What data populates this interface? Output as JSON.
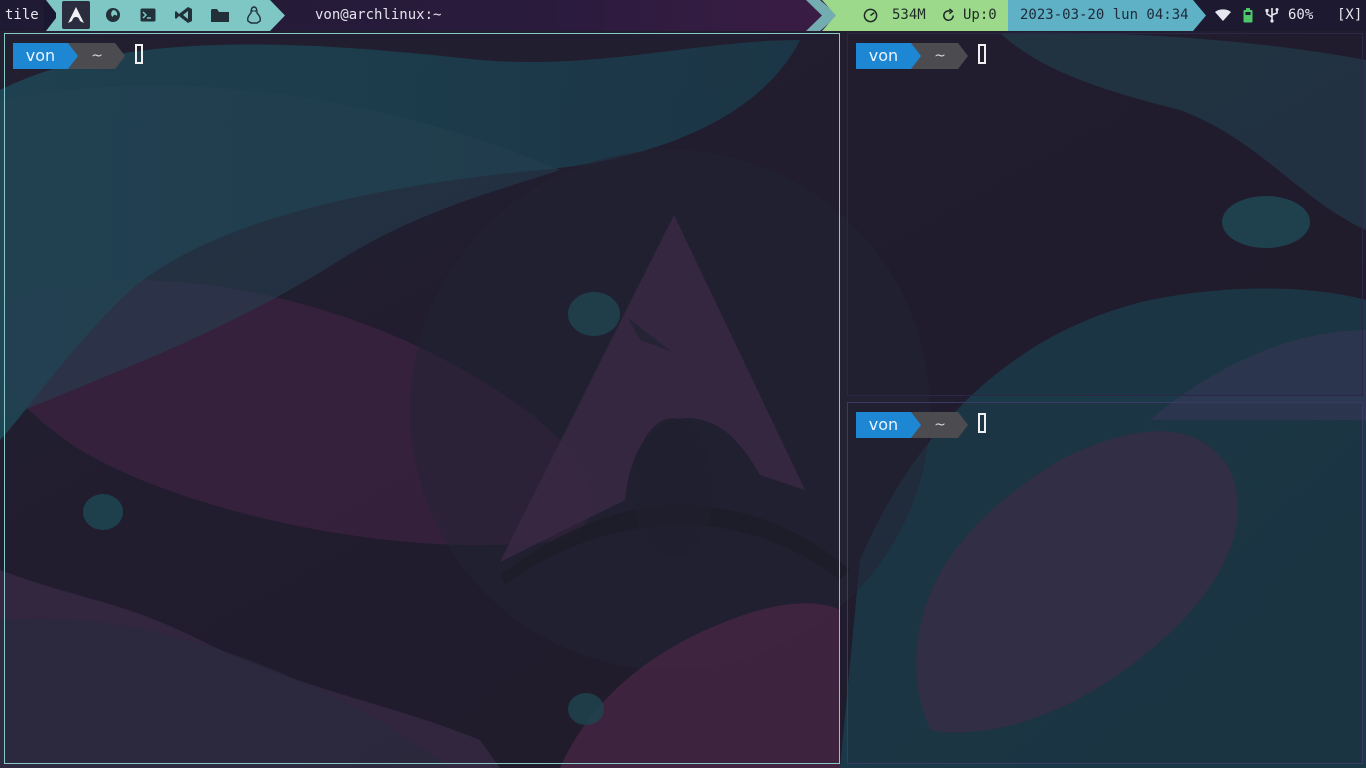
{
  "topbar": {
    "layout_label": "tile",
    "workspaces": [
      {
        "icon": "arch-logo-icon",
        "active": true
      },
      {
        "icon": "firefox-icon",
        "active": false
      },
      {
        "icon": "terminal-icon",
        "active": false
      },
      {
        "icon": "vscode-icon",
        "active": false
      },
      {
        "icon": "folder-icon",
        "active": false
      },
      {
        "icon": "linux-tux-icon",
        "active": false
      }
    ],
    "window_title": "von@archlinux:~",
    "memory": "534M",
    "updates": "Up:0",
    "datetime": "2023-03-20 lun 04:34",
    "tray": {
      "wifi_icon": "wifi-icon",
      "battery_icon": "battery-icon",
      "usb_icon": "usb-icon",
      "battery_level": "60%",
      "close_label": "[X]"
    },
    "colors": {
      "workspace_bg": "#7fc7c4",
      "memory_bg": "#9dd98b",
      "date_bg": "#5fb2c6"
    }
  },
  "terminals": [
    {
      "id": "left",
      "user": "von",
      "dir": "~"
    },
    {
      "id": "top-right",
      "user": "von",
      "dir": "~"
    },
    {
      "id": "bottom-right",
      "user": "von",
      "dir": "~"
    }
  ],
  "prompt_colors": {
    "user_bg": "#1d87d4",
    "dir_bg": "#4c4c50"
  }
}
